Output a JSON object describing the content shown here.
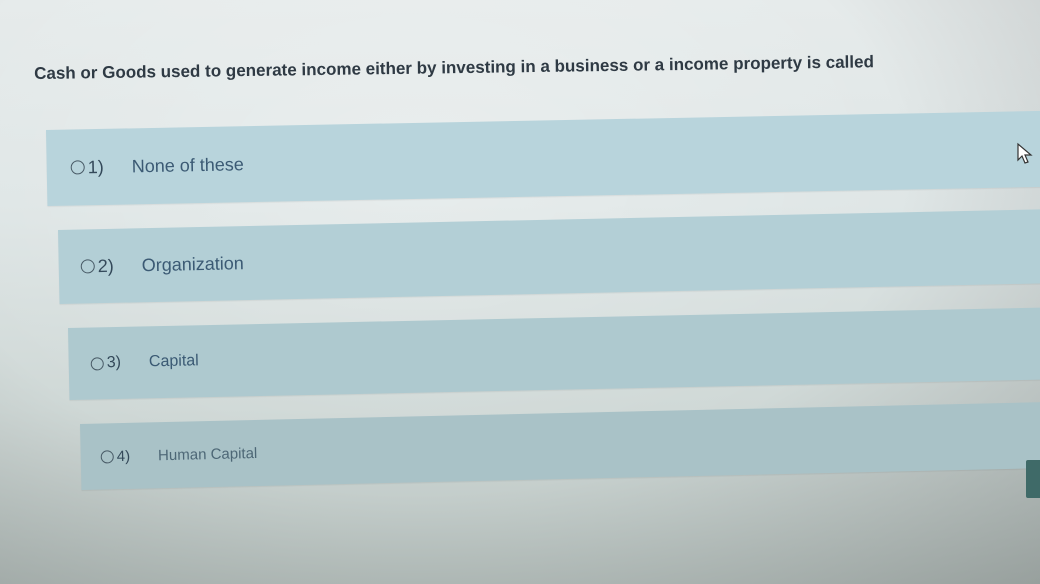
{
  "question": {
    "text": "Cash or Goods used to generate income either by investing in a business or a income property is called"
  },
  "options": [
    {
      "number": "1)",
      "label": "None of these"
    },
    {
      "number": "2)",
      "label": "Organization"
    },
    {
      "number": "3)",
      "label": "Capital"
    },
    {
      "number": "4)",
      "label": "Human Capital"
    }
  ],
  "colors": {
    "option_background": "#b9d3da",
    "option_text": "#3b5a74",
    "question_text": "#2f3a44"
  },
  "icons": {
    "cursor": "mouse-pointer-icon",
    "radio": "radio-button-icon"
  }
}
